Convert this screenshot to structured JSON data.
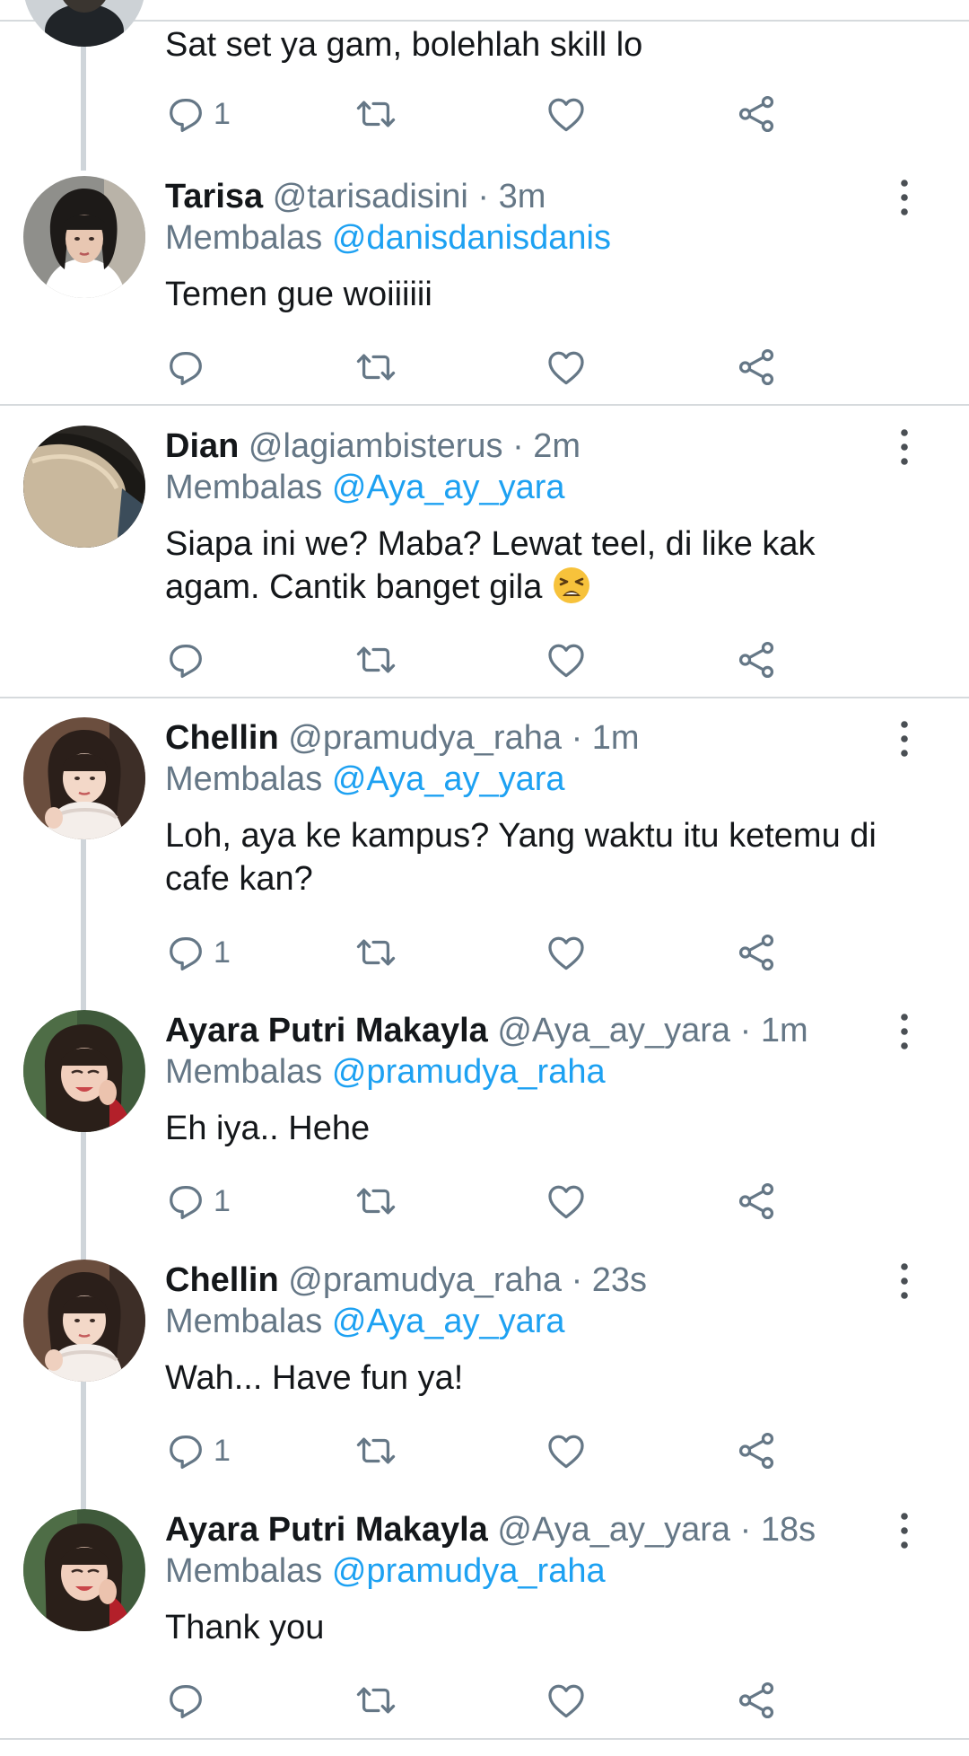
{
  "top_partial": {
    "body": "Sat set ya gam, bolehlah skill lo",
    "reply_count": "1"
  },
  "tweets": [
    {
      "name": "Tarisa",
      "handle": "@tarisadisini",
      "time": "· 3m",
      "reply_prefix": "Membalas",
      "reply_to": "@danisdanisdanis",
      "body_lines": [
        "Temen gue woiiiiii"
      ],
      "reply_count": ""
    },
    {
      "name": "Dian",
      "handle": "@lagiambisterus",
      "time": "· 2m",
      "reply_prefix": "Membalas",
      "reply_to": "@Aya_ay_yara",
      "body_lines": [
        "Siapa ini we? Maba? Lewat teel, di like kak",
        "agam. Cantik banget gila"
      ],
      "emoji": "tired-face-emoji",
      "reply_count": ""
    },
    {
      "name": "Chellin",
      "handle": "@pramudya_raha",
      "time": "· 1m",
      "reply_prefix": "Membalas",
      "reply_to": "@Aya_ay_yara",
      "body_lines": [
        "Loh, aya ke kampus? Yang waktu itu ketemu di",
        "cafe kan?"
      ],
      "reply_count": "1"
    },
    {
      "name": "Ayara Putri Makayla",
      "handle": "@Aya_ay_yara",
      "time": "· 1m",
      "reply_prefix": "Membalas",
      "reply_to": "@pramudya_raha",
      "body_lines": [
        "Eh iya.. Hehe"
      ],
      "reply_count": "1"
    },
    {
      "name": "Chellin",
      "handle": "@pramudya_raha",
      "time": "· 23s",
      "reply_prefix": "Membalas",
      "reply_to": "@Aya_ay_yara",
      "body_lines": [
        "Wah... Have fun ya!"
      ],
      "reply_count": "1"
    },
    {
      "name": "Ayara Putri Makayla",
      "handle": "@Aya_ay_yara",
      "time": "· 18s",
      "reply_prefix": "Membalas",
      "reply_to": "@pramudya_raha",
      "body_lines": [
        "Thank you"
      ],
      "reply_count": ""
    }
  ],
  "icons": {
    "reply": "reply-icon",
    "retweet": "retweet-icon",
    "like": "like-icon",
    "share": "share-icon",
    "more": "more-vertical-icon"
  },
  "colors": {
    "link": "#1da1f2",
    "secondary_text": "#657786",
    "divider": "#d6dadd",
    "thread_line": "#cfd5da"
  }
}
